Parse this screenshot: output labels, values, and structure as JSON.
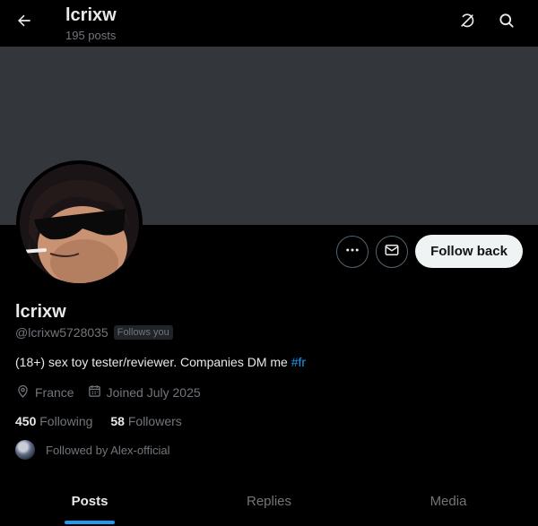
{
  "header": {
    "title": "lcrixw",
    "subtitle": "195 posts"
  },
  "icons": {
    "back": "arrow-left-icon",
    "grok": "grok-icon",
    "search": "search-icon",
    "more": "more-dots-icon",
    "message": "envelope-icon",
    "location": "location-pin-icon",
    "calendar": "calendar-icon"
  },
  "profile": {
    "name": "lcrixw",
    "handle": "@lcrixw5728035",
    "follows_you_badge": "Follows you",
    "bio_text": "(18+) sex toy tester/reviewer. Companies DM me ",
    "bio_hashtag": "#fr",
    "location": "France",
    "joined": "Joined July 2025",
    "following_count": "450",
    "following_label": "Following",
    "followers_count": "58",
    "followers_label": "Followers",
    "followed_by": "Followed by Alex-official"
  },
  "actions": {
    "follow_back_label": "Follow back"
  },
  "tabs": [
    {
      "label": "Posts",
      "active": true
    },
    {
      "label": "Replies",
      "active": false
    },
    {
      "label": "Media",
      "active": false
    }
  ],
  "colors": {
    "background": "#000000",
    "banner": "#33363b",
    "accent": "#1d9bf0",
    "text_primary": "#e7e9ea",
    "text_secondary": "#71767b",
    "button_bg": "#eff3f4"
  }
}
